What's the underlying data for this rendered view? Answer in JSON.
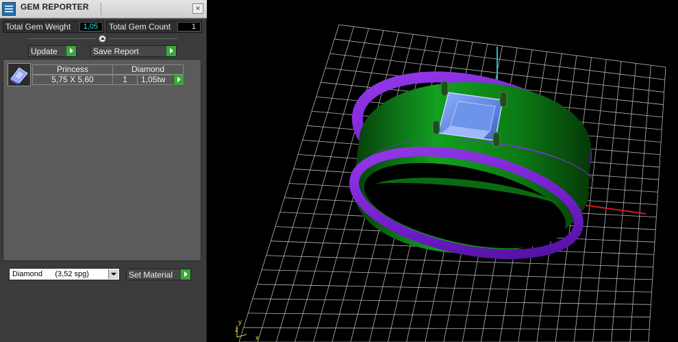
{
  "panel": {
    "title": "GEM REPORTER",
    "close_glyph": "×",
    "total_weight_label": "Total Gem Weight",
    "total_weight_value": "1,05",
    "total_count_label": "Total Gem Count",
    "total_count_value": "1",
    "update_label": "Update",
    "save_report_label": "Save Report",
    "gems": [
      {
        "cut": "Princess",
        "dimensions": "5,75 X 5,60",
        "material": "Diamond",
        "count": "1",
        "weight": "1,05tw"
      }
    ],
    "material_select": "Diamond      (3,52 spg)",
    "set_material_label": "Set Material"
  },
  "viewport": {
    "axis_labels": {
      "y": "y",
      "z": "z",
      "x": "x"
    }
  },
  "colors": {
    "band_purple": "#7a1fd6",
    "band_green": "#0f8a1a",
    "stone_blue": "#5b86d8",
    "prong_green": "#1e4e1e",
    "grid": "#b8b8b8",
    "value_cyan": "#33e0ff"
  },
  "icons": {
    "app": "gem-reporter-icon",
    "close": "close-icon",
    "go": "play-arrow-icon",
    "collapse": "chevron-up-icon",
    "dropdown": "chevron-down-icon",
    "gem": "princess-gem-icon"
  }
}
